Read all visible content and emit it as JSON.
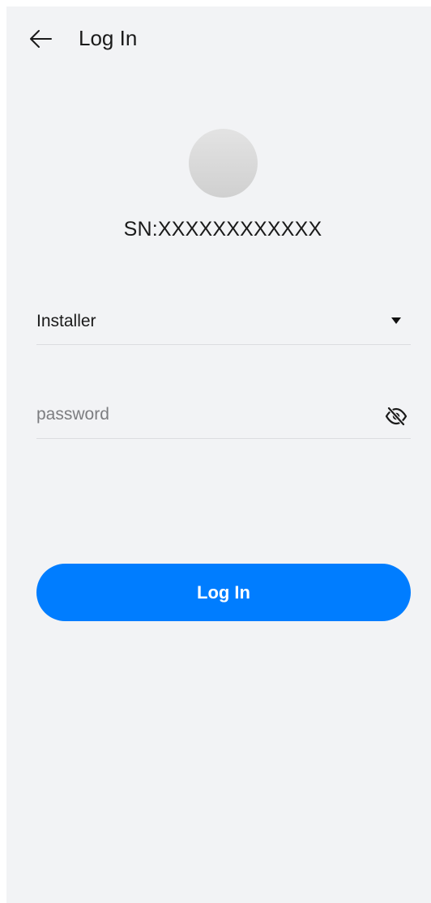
{
  "header": {
    "title": "Log In",
    "back_icon": "arrow-left-icon"
  },
  "device": {
    "sn": "SN:XXXXXXXXXXXX"
  },
  "form": {
    "role": {
      "value": "Installer",
      "icon": "triangle-down-icon"
    },
    "password": {
      "value": "",
      "placeholder": "password",
      "icon": "eye-off-icon"
    },
    "submit_label": "Log In"
  },
  "colors": {
    "accent": "#007dff",
    "background": "#f2f3f5",
    "text": "#1a1a1a",
    "placeholder": "#7c7d80",
    "divider": "#dcdde0"
  }
}
